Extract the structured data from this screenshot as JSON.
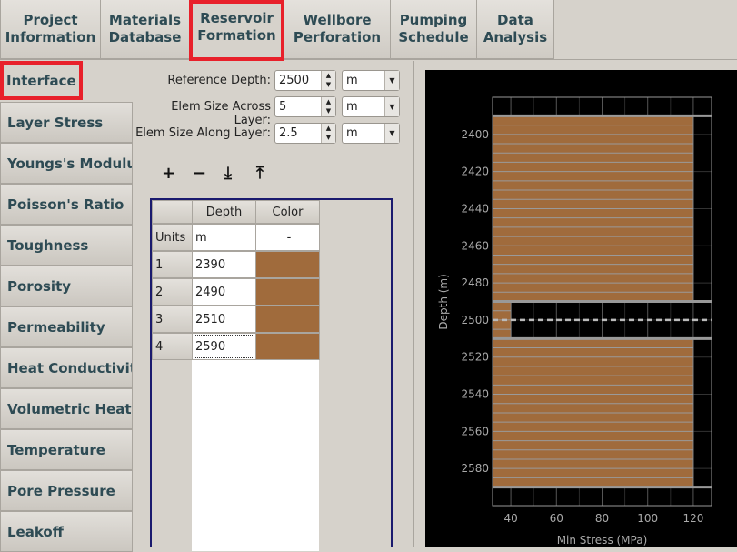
{
  "tabs": [
    {
      "label": "Project\nInformation"
    },
    {
      "label": "Materials\nDatabase"
    },
    {
      "label": "Reservoir\nFormation"
    },
    {
      "label": "Wellbore\nPerforation"
    },
    {
      "label": "Pumping\nSchedule"
    },
    {
      "label": "Data\nAnalysis"
    }
  ],
  "active_tab": "Reservoir Formation",
  "sidebar": {
    "items": [
      {
        "label": "Interface"
      },
      {
        "label": "Layer Stress"
      },
      {
        "label": "Youngs's Modulus"
      },
      {
        "label": "Poisson's Ratio"
      },
      {
        "label": "Toughness"
      },
      {
        "label": "Porosity"
      },
      {
        "label": "Permeability"
      },
      {
        "label": "Heat Conductivity"
      },
      {
        "label": "Volumetric Heat Capacity"
      },
      {
        "label": "Temperature"
      },
      {
        "label": "Pore Pressure"
      },
      {
        "label": "Leakoff"
      }
    ],
    "selected": "Interface"
  },
  "form": {
    "reference_depth": {
      "label": "Reference Depth:",
      "value": "2500",
      "unit": "m"
    },
    "elem_across": {
      "label": "Elem Size Across Layer:",
      "value": "5",
      "unit": "m"
    },
    "elem_along": {
      "label": "Elem Size Along Layer:",
      "value": "2.5",
      "unit": "m"
    }
  },
  "toolbar": {
    "add": "+",
    "remove": "−",
    "import": "⤓",
    "export": "⤒"
  },
  "table": {
    "columns": [
      "Depth",
      "Color"
    ],
    "units": {
      "label": "Units",
      "depth": "m",
      "color": "-"
    },
    "rows": [
      {
        "id": "1",
        "depth": "2390",
        "color": "#a06b3c"
      },
      {
        "id": "2",
        "depth": "2490",
        "color": "#a06b3c"
      },
      {
        "id": "3",
        "depth": "2510",
        "color": "#a06b3c"
      },
      {
        "id": "4",
        "depth": "2590",
        "color": "#a06b3c"
      }
    ]
  },
  "chart_data": {
    "type": "bar",
    "orientation": "horizontal",
    "xlabel": "Min Stress (MPa)",
    "ylabel": "Depth (m)",
    "xlim": [
      32,
      128
    ],
    "ylim": [
      2380,
      2600
    ],
    "y_inverted": true,
    "xticks": [
      "40",
      "60",
      "80",
      "100",
      "120"
    ],
    "yticks": [
      "2400",
      "2420",
      "2440",
      "2460",
      "2480",
      "2500",
      "2520",
      "2540",
      "2560",
      "2580"
    ],
    "layers": [
      {
        "top": 2390,
        "bottom": 2490,
        "min_stress": 120
      },
      {
        "top": 2490,
        "bottom": 2510,
        "min_stress": 40
      },
      {
        "top": 2510,
        "bottom": 2590,
        "min_stress": 120
      }
    ],
    "mesh_spacing": 5,
    "reference_depth": 2500,
    "bar_color": "#a06b3c",
    "background": "#000000",
    "grid": true
  }
}
